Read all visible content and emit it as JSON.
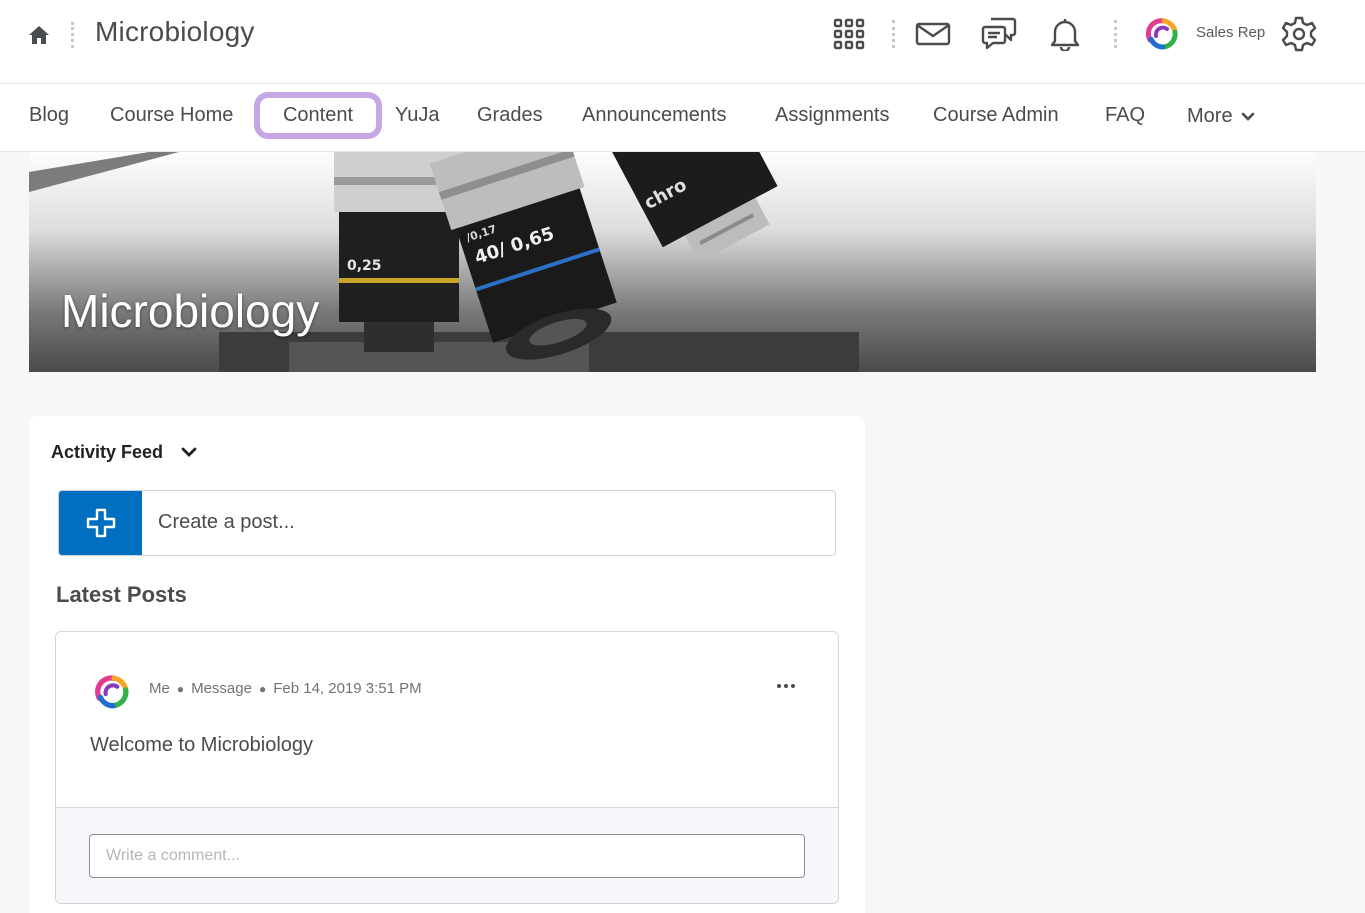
{
  "minibar": {
    "course_title": "Microbiology",
    "user_name": "Sales Rep",
    "icons": [
      "home-icon",
      "waffle-grid-icon",
      "mail-icon",
      "chat-icon",
      "bell-icon",
      "user-avatar-logo",
      "gear-icon"
    ]
  },
  "navbar": {
    "items": [
      "Blog",
      "Course Home",
      "Content",
      "YuJa",
      "Grades",
      "Announcements",
      "Assignments",
      "Course Admin",
      "FAQ"
    ],
    "more_label": "More",
    "active_item": "Content",
    "highlight_color": "#c6a7e6"
  },
  "banner": {
    "title": "Microbiology",
    "lens_labels": [
      "0,25",
      "40/ 0,65",
      "/0,17",
      "chro"
    ]
  },
  "activity_feed": {
    "header": "Activity Feed",
    "create_post_placeholder": "Create a post...",
    "latest_posts_heading": "Latest Posts",
    "accent_color": "#006fbf",
    "posts": [
      {
        "author": "Me",
        "type": "Message",
        "timestamp": "Feb 14, 2019 3:51 PM",
        "body": "Welcome to Microbiology",
        "comment_placeholder": "Write a comment..."
      }
    ]
  }
}
